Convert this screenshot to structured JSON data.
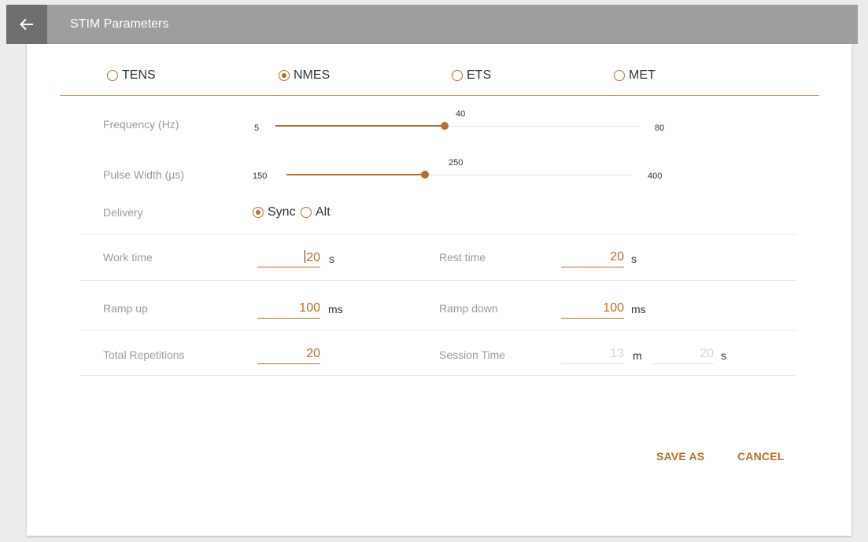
{
  "appbar": {
    "title": "STIM Parameters",
    "back_icon": "arrow-left-icon",
    "color": "#9e9e9e"
  },
  "modes": [
    {
      "label": "TENS",
      "selected": false
    },
    {
      "label": "NMES",
      "selected": true
    },
    {
      "label": "ETS",
      "selected": false
    },
    {
      "label": "MET",
      "selected": false
    }
  ],
  "accent_color": "#b86e2a",
  "frequency": {
    "label": "Frequency (Hz)",
    "min": "5",
    "max": "80",
    "value": "40",
    "level": 0.47
  },
  "pulse_width": {
    "label": "Pulse Width (µs)",
    "min": "150",
    "max": "400",
    "value": "250",
    "level": 0.4
  },
  "delivery": {
    "label": "Delivery",
    "options": [
      {
        "label": "Sync",
        "selected": true
      },
      {
        "label": "Alt",
        "selected": false
      }
    ]
  },
  "work_time": {
    "label": "Work time",
    "value": "20",
    "unit": "s"
  },
  "rest_time": {
    "label": "Rest time",
    "value": "20",
    "unit": "s"
  },
  "ramp_up": {
    "label": "Ramp up",
    "value": "100",
    "unit": "ms"
  },
  "ramp_down": {
    "label": "Ramp down",
    "value": "100",
    "unit": "ms"
  },
  "total_repetitions": {
    "label": "Total Repetitions",
    "value": "20"
  },
  "session_time": {
    "label": "Session Time",
    "minutes": "13",
    "minutes_unit": "m",
    "seconds": "20",
    "seconds_unit": "s"
  },
  "actions": {
    "save_as": "SAVE AS",
    "cancel": "CANCEL"
  }
}
